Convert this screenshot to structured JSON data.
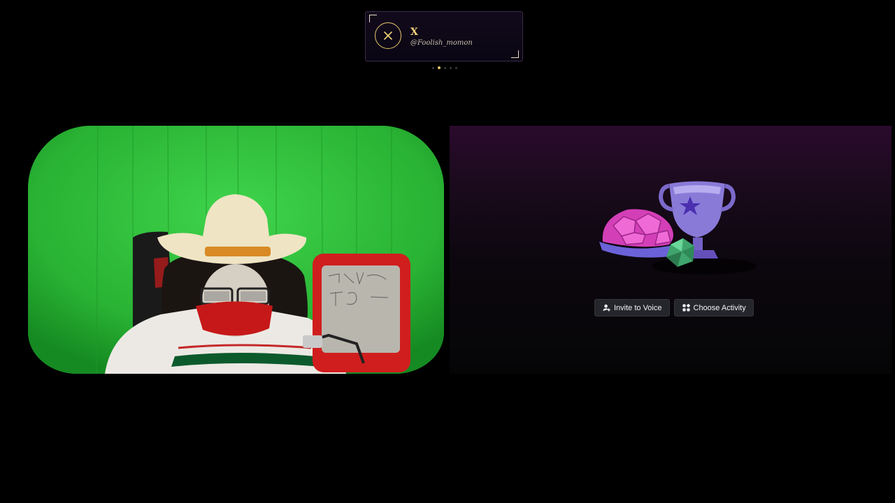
{
  "social": {
    "icon": "x-icon",
    "name": "X",
    "handle": "@Foolish_momon",
    "accent": "#e8c66a",
    "pager": {
      "count": 5,
      "active": 1
    }
  },
  "webcam": {
    "background_color": "#2fb83a"
  },
  "activity_panel": {
    "illustration": "activity-trophy-illustration",
    "buttons": [
      {
        "icon": "user-add-icon",
        "label": "Invite to Voice"
      },
      {
        "icon": "apps-icon",
        "label": "Choose Activity"
      }
    ]
  }
}
